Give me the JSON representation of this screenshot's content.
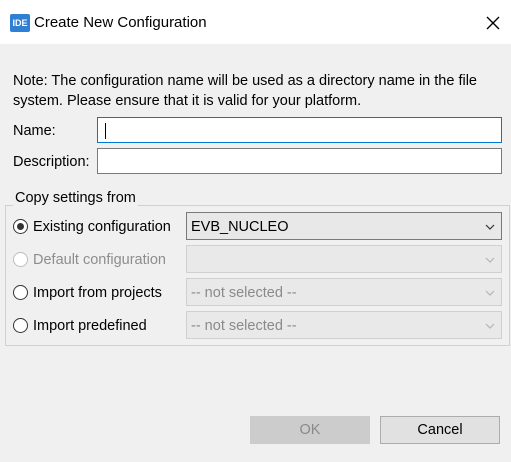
{
  "window": {
    "app_icon_text": "IDE",
    "title": "Create New Configuration",
    "close_icon": "close-icon"
  },
  "note": "Note: The configuration name will be used as a directory name in the file system.  Please ensure that it is valid for your platform.",
  "fields": {
    "name_label": "Name:",
    "name_value": "",
    "description_label": "Description:",
    "description_value": ""
  },
  "copy_settings": {
    "group_title": "Copy settings from",
    "options": [
      {
        "label": "Existing configuration",
        "selected": true,
        "enabled": true,
        "combo_value": "EVB_NUCLEO"
      },
      {
        "label": "Default configuration",
        "selected": false,
        "enabled": false,
        "combo_value": ""
      },
      {
        "label": "Import from projects",
        "selected": false,
        "enabled": true,
        "combo_value": "-- not selected --"
      },
      {
        "label": "Import predefined",
        "selected": false,
        "enabled": true,
        "combo_value": "-- not selected --"
      }
    ]
  },
  "buttons": {
    "ok_label": "OK",
    "ok_enabled": false,
    "cancel_label": "Cancel"
  },
  "colors": {
    "focus_border": "#0078d7",
    "app_icon_bg": "#2f7fd3",
    "window_bg": "#f0f0f0"
  }
}
